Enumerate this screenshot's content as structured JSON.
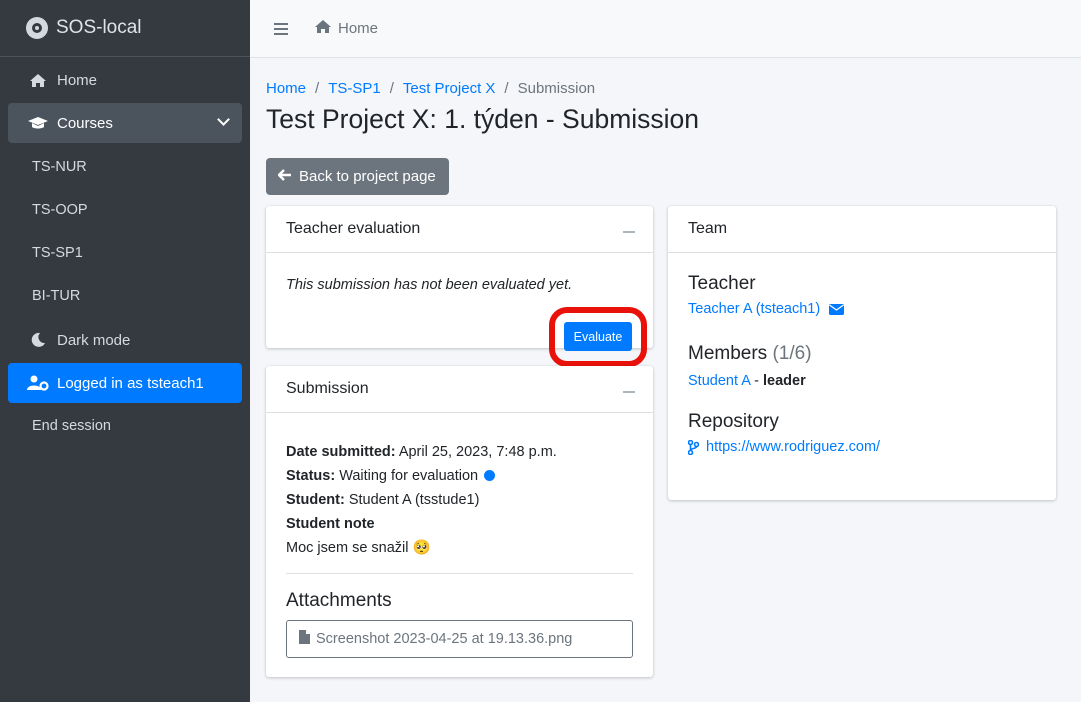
{
  "app": {
    "title": "SOS-local"
  },
  "sidebar": {
    "items": [
      {
        "label": "Home",
        "icon": "home-icon"
      },
      {
        "label": "Courses",
        "icon": "graduation-cap-icon"
      }
    ],
    "courses": [
      "TS-NUR",
      "TS-OOP",
      "TS-SP1",
      "BI-TUR"
    ],
    "dark_mode": "Dark mode",
    "logged_in": "Logged in as tsteach1",
    "end_session": "End session"
  },
  "topbar": {
    "home": "Home"
  },
  "breadcrumb": {
    "items": [
      "Home",
      "TS-SP1",
      "Test Project X"
    ],
    "current": "Submission"
  },
  "page": {
    "title": "Test Project X: 1. týden - Submission",
    "back_label": "Back to project page"
  },
  "evaluation": {
    "title": "Teacher evaluation",
    "message": "This submission has not been evaluated yet.",
    "evaluate_label": "Evaluate"
  },
  "submission": {
    "title": "Submission",
    "date_label": "Date submitted:",
    "date_value": "April 25, 2023, 7:48 p.m.",
    "status_label": "Status:",
    "status_value": "Waiting for evaluation",
    "student_label": "Student:",
    "student_value": "Student A (tsstude1)",
    "note_label": "Student note",
    "note_value": "Moc jsem se snažil 🥺",
    "attachments_title": "Attachments",
    "attachment_file": "Screenshot 2023-04-25 at 19.13.36.png"
  },
  "team": {
    "title": "Team",
    "teacher_heading": "Teacher",
    "teacher_name": "Teacher A (tsteach1)",
    "members_heading": "Members",
    "members_count": "(1/6)",
    "member_name": "Student A",
    "member_sep": " - ",
    "member_role": "leader",
    "repo_heading": "Repository",
    "repo_url": "https://www.rodriguez.com/"
  },
  "colors": {
    "accent": "#007bff",
    "sidebar_bg": "#343a40",
    "highlight": "#e8120a"
  }
}
